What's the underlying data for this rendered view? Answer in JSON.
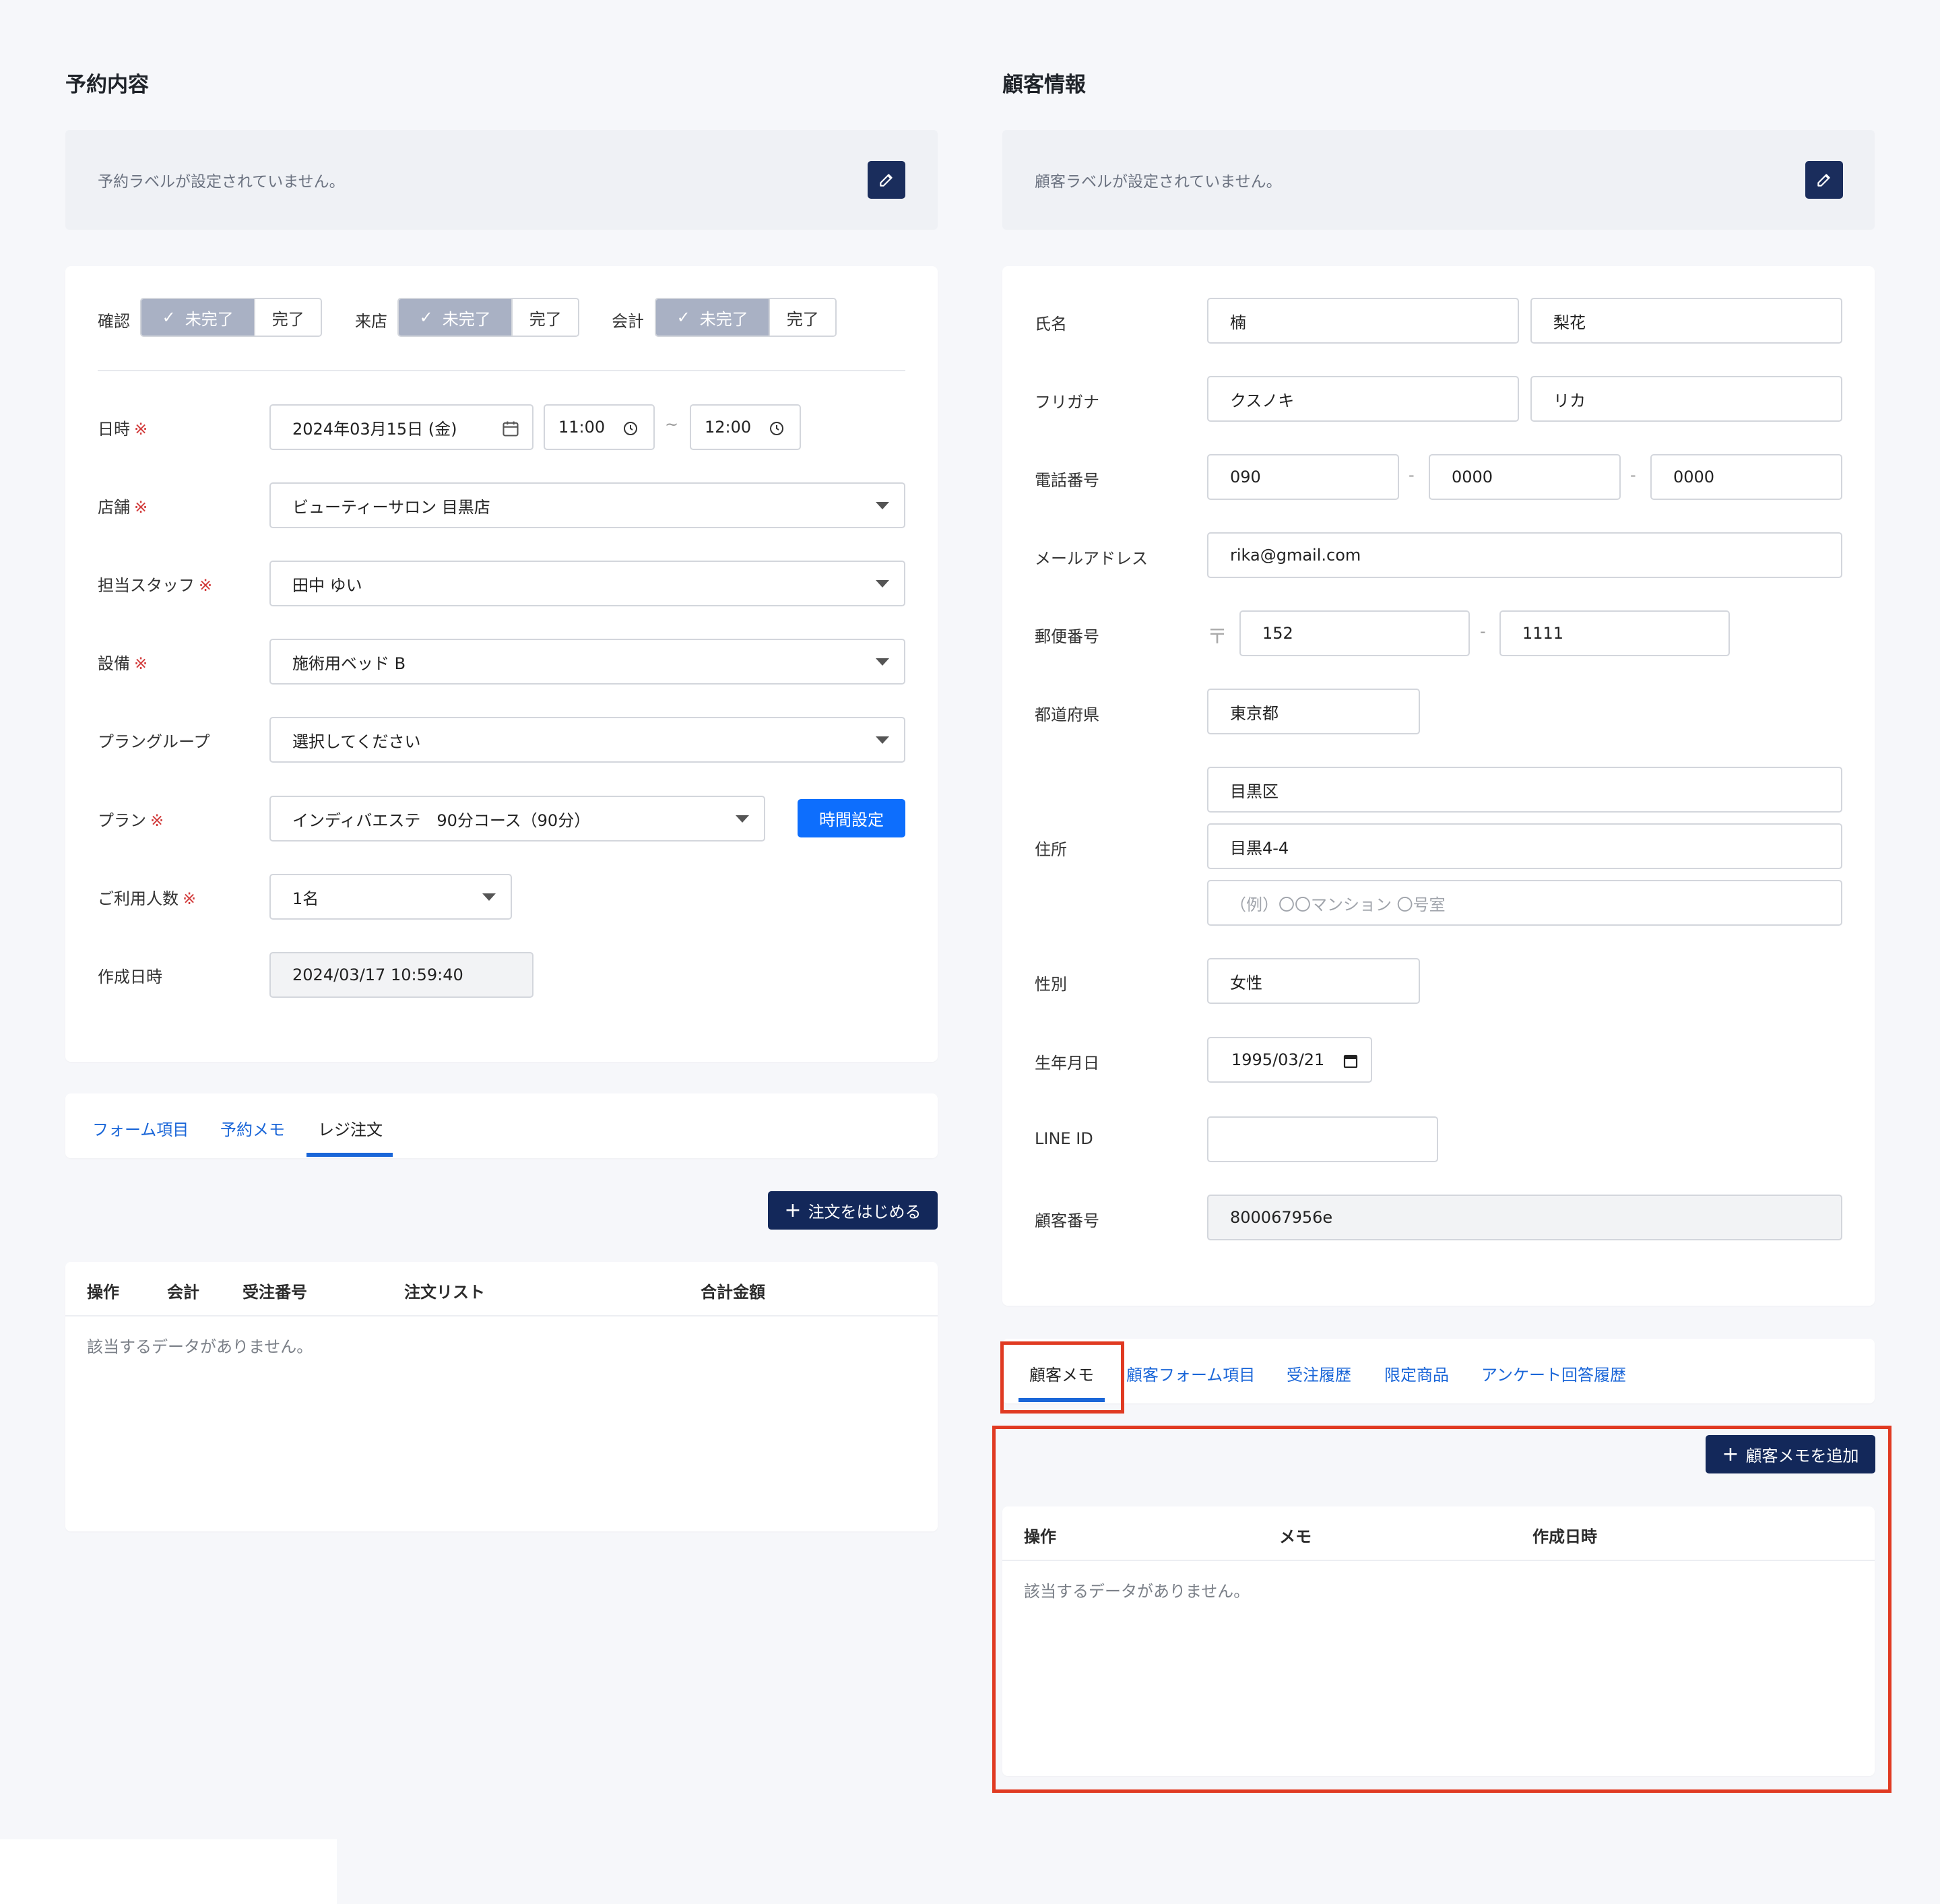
{
  "reservation": {
    "title": "予約内容",
    "label_empty": "予約ラベルが設定されていません。",
    "status": {
      "confirm_label": "確認",
      "visit_label": "来店",
      "payment_label": "会計",
      "incomplete": "未完了",
      "complete": "完了"
    },
    "datetime_label": "日時",
    "date": "2024年03月15日 (金)",
    "start_time": "11:00",
    "tilde": "~",
    "end_time": "12:00",
    "store_label": "店舗",
    "store": "ビューティーサロン 目黒店",
    "staff_label": "担当スタッフ",
    "staff": "田中 ゆい",
    "equipment_label": "設備",
    "equipment": "施術用ベッド B",
    "plan_group_label": "プラングループ",
    "plan_group": "選択してください",
    "plan_label": "プラン",
    "plan": "インディバエステ　90分コース（90分）",
    "time_setting_button": "時間設定",
    "guests_label": "ご利用人数",
    "guests": "1名",
    "created_label": "作成日時",
    "created": "2024/03/17 10:59:40",
    "required_mark": "※",
    "tabs": [
      "フォーム項目",
      "予約メモ",
      "レジ注文"
    ],
    "start_order_button": "注文をはじめる",
    "order_table": {
      "columns": [
        "操作",
        "会計",
        "受注番号",
        "注文リスト",
        "合計金額"
      ],
      "empty": "該当するデータがありません。"
    }
  },
  "customer": {
    "title": "顧客情報",
    "label_empty": "顧客ラベルが設定されていません。",
    "name_label": "氏名",
    "last_name": "楠",
    "first_name": "梨花",
    "kana_label": "フリガナ",
    "last_kana": "クスノキ",
    "first_kana": "リカ",
    "phone_label": "電話番号",
    "phone1": "090",
    "phone2": "0000",
    "phone3": "0000",
    "email_label": "メールアドレス",
    "email": "rika@gmail.com",
    "postal_label": "郵便番号",
    "postal_mark": "〒",
    "postal1": "152",
    "postal2": "1111",
    "prefecture_label": "都道府県",
    "prefecture": "東京都",
    "address_label": "住所",
    "address1": "目黒区",
    "address2": "目黒4-4",
    "address3_placeholder": "（例）〇〇マンション 〇号室",
    "gender_label": "性別",
    "gender": "女性",
    "birthday_label": "生年月日",
    "birthday": "1995/03/21",
    "line_label": "LINE ID",
    "line_id": "",
    "customer_no_label": "顧客番号",
    "customer_no": "800067956e",
    "dash": "-",
    "tabs": [
      "顧客メモ",
      "顧客フォーム項目",
      "受注履歴",
      "限定商品",
      "アンケート回答履歴"
    ],
    "add_memo_button": "顧客メモを追加",
    "memo_table": {
      "columns": [
        "操作",
        "メモ",
        "作成日時"
      ],
      "empty": "該当するデータがありません。"
    }
  },
  "colors": {
    "primary_dark": "#13285a",
    "primary_blue": "#0d6efd",
    "tab_link": "#1a66d8",
    "required": "#d23b3b",
    "highlight": "#e03a22"
  }
}
